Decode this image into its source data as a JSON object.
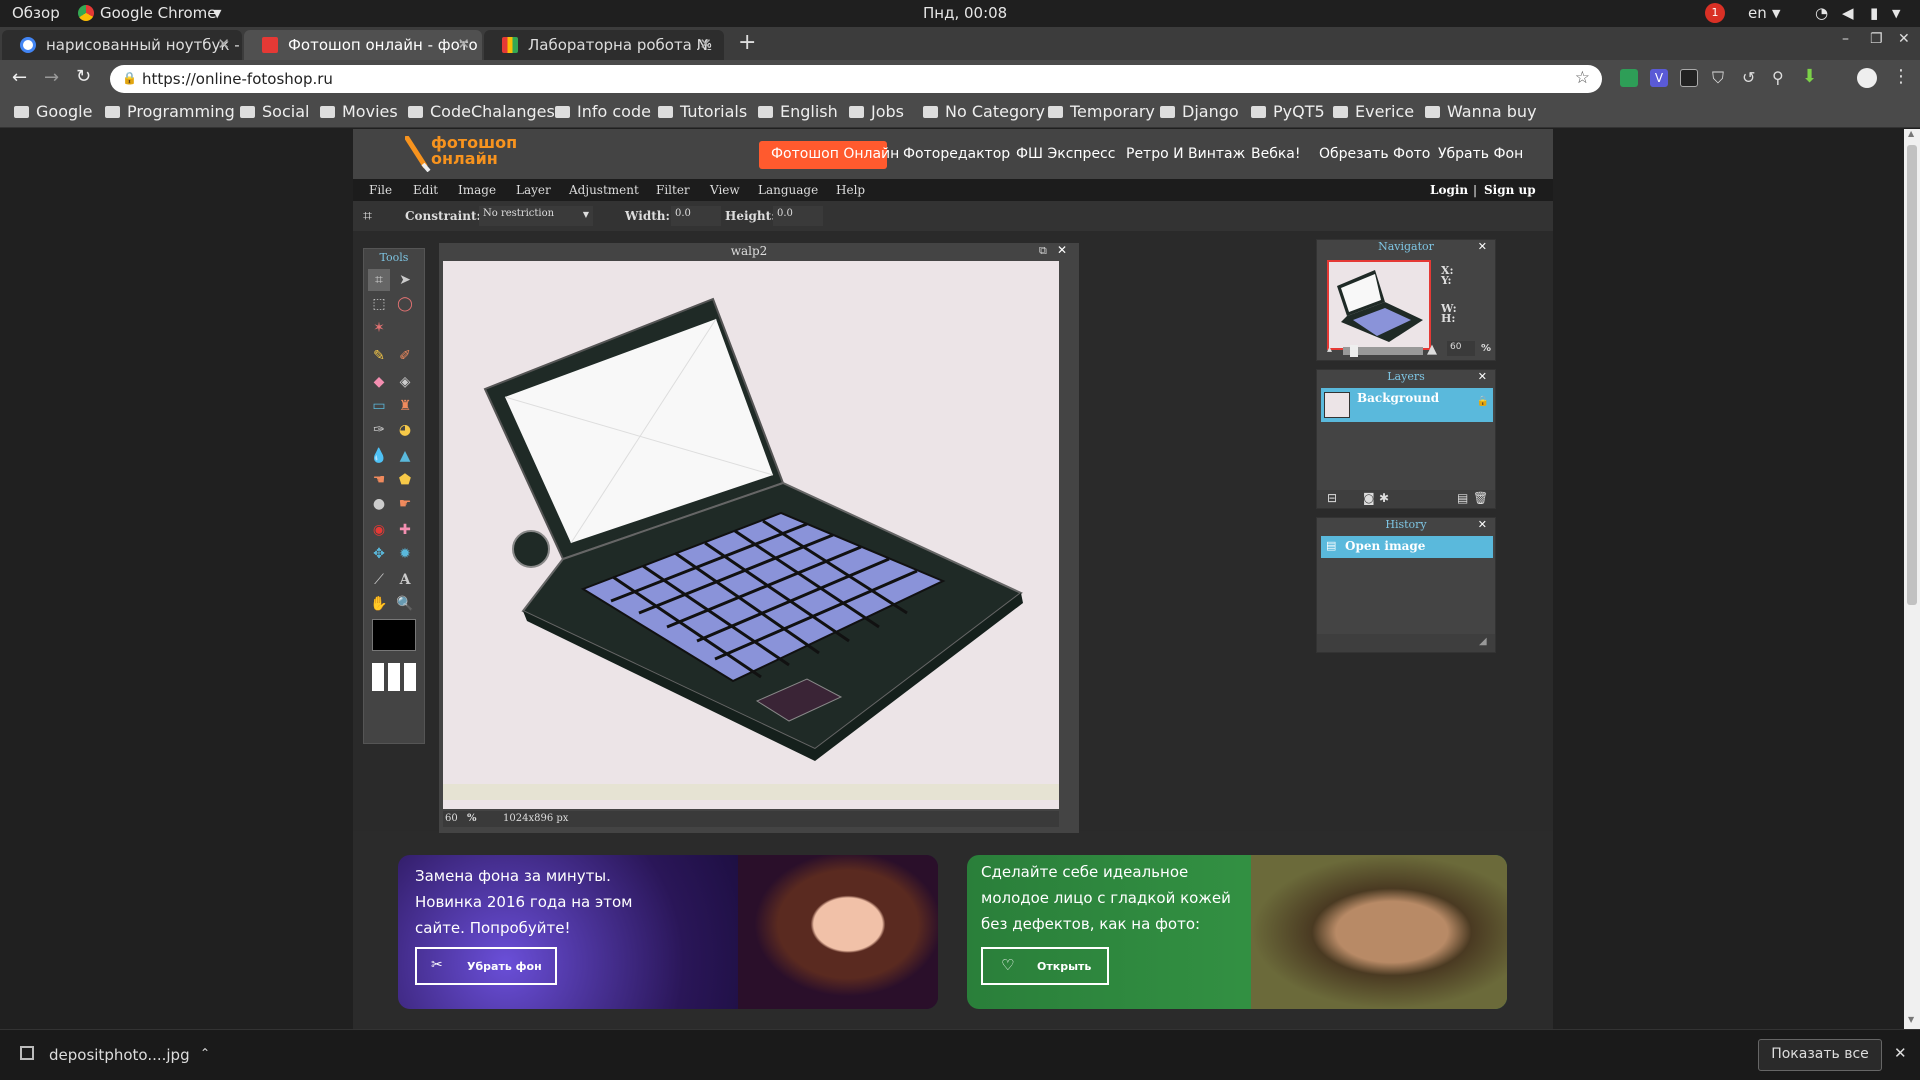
{
  "os": {
    "overview": "Обзор",
    "app": "Google Chrome",
    "clock": "Пнд, 00:08",
    "lang": "en",
    "notify_count": "1"
  },
  "tabs": [
    {
      "title": "нарисованный ноутбук -",
      "icon_color": "#4285f4"
    },
    {
      "title": "Фотошоп онлайн - фото",
      "icon_color": "#e53935"
    },
    {
      "title": "Лабораторна робота №",
      "icon_color": "#f4b400"
    }
  ],
  "address": {
    "url": "https://online-fotoshop.ru"
  },
  "bookmarks": [
    "Google",
    "Programming",
    "Social",
    "Movies",
    "CodeChalanges",
    "Info code",
    "Tutorials",
    "English",
    "Jobs",
    "No Category",
    "Temporary",
    "Django",
    "PyQT5",
    "Everice",
    "Wanna buy"
  ],
  "site": {
    "logo_line1": "фотошоп",
    "logo_line2": "онлайн",
    "nav": [
      "Фотошоп Онлайн",
      "Фоторедактор",
      "ФШ Экспресс",
      "Ретро И Винтаж",
      "Вебка!",
      "Обрезать Фото",
      "Убрать Фон"
    ],
    "menu": [
      "File",
      "Edit",
      "Image",
      "Layer",
      "Adjustment",
      "Filter",
      "View",
      "Language",
      "Help"
    ],
    "login": "Login",
    "separator": "|",
    "signup": "Sign up",
    "options": {
      "constraint_label": "Constraint:",
      "constraint_value": "No restriction",
      "width_label": "Width:",
      "width_value": "0.0",
      "height_label": "Height:",
      "height_value": "0.0"
    },
    "tools_title": "Tools",
    "document": {
      "title": "walp2",
      "zoom": "60",
      "zoom_unit": "%",
      "size": "1024x896 px"
    },
    "navigator": {
      "title": "Navigator",
      "x_label": "X:",
      "y_label": "Y:",
      "w_label": "W:",
      "h_label": "H:",
      "zoom": "60",
      "zoom_unit": "%",
      "zoom_level": 0.1
    },
    "layers": {
      "title": "Layers",
      "items": [
        "Background"
      ]
    },
    "history": {
      "title": "History",
      "items": [
        "Open image"
      ]
    },
    "ads": [
      {
        "text_lines": [
          "Замена фона за минуты.",
          "Новинка 2016 года на этом",
          "сайте. Попробуйте!"
        ],
        "button": "Убрать фон"
      },
      {
        "text_lines": [
          "Сделайте себе идеальное",
          "молодое лицо с гладкой кожей",
          "без дефектов, как на фото:"
        ],
        "button": "Открыть"
      }
    ]
  },
  "download": {
    "file": "depositphoto....jpg",
    "show_all": "Показать все"
  }
}
